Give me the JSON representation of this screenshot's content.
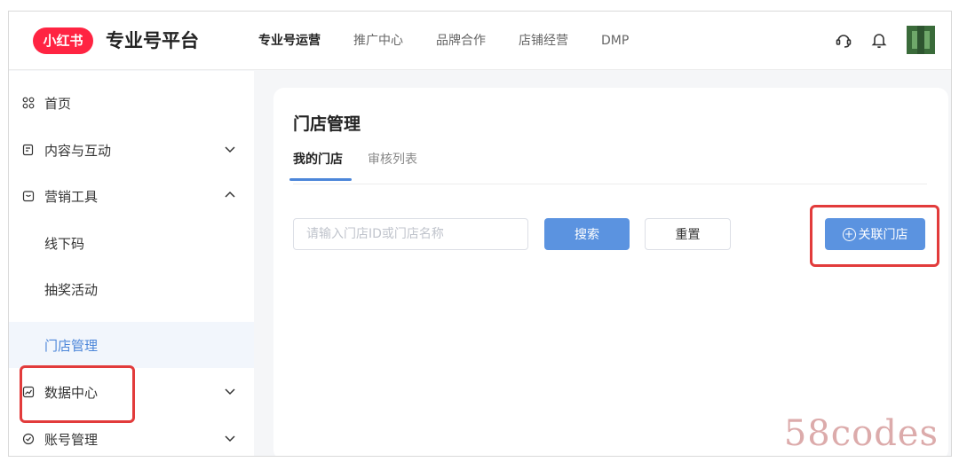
{
  "brand": {
    "logo_text": "小红书",
    "title": "专业号平台"
  },
  "nav": {
    "items": [
      {
        "label": "专业号运营",
        "active": true
      },
      {
        "label": "推广中心",
        "active": false
      },
      {
        "label": "品牌合作",
        "active": false
      },
      {
        "label": "店铺经营",
        "active": false
      },
      {
        "label": "DMP",
        "active": false
      }
    ]
  },
  "header_icons": [
    "headset-icon",
    "bell-icon",
    "avatar"
  ],
  "sidebar": {
    "items": [
      {
        "label": "首页",
        "icon": "grid-icon"
      },
      {
        "label": "内容与互动",
        "icon": "content-icon",
        "chevron": "down"
      },
      {
        "label": "营销工具",
        "icon": "marketing-icon",
        "chevron": "up"
      },
      {
        "label": "线下码",
        "sub": true
      },
      {
        "label": "抽奖活动",
        "sub": true
      },
      {
        "label": "门店管理",
        "sub": true,
        "selected": true
      },
      {
        "label": "数据中心",
        "icon": "chart-icon",
        "chevron": "down"
      },
      {
        "label": "账号管理",
        "icon": "account-icon",
        "chevron": "down"
      }
    ]
  },
  "main": {
    "title": "门店管理",
    "tabs": [
      {
        "label": "我的门店",
        "active": true
      },
      {
        "label": "审核列表",
        "active": false
      }
    ],
    "search_placeholder": "请输入门店ID或门店名称",
    "search_value": "",
    "search_button": "搜索",
    "reset_button": "重置",
    "link_button": "关联门店"
  },
  "watermark": "58codes",
  "colors": {
    "accent": "#5b93e0",
    "brand_red": "#ff2442",
    "highlight_box": "#e23b3b"
  }
}
